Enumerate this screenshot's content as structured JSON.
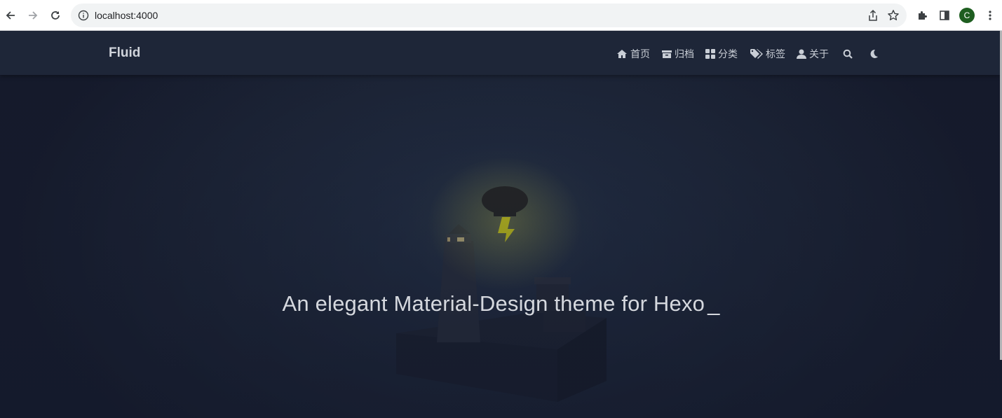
{
  "browser": {
    "url": "localhost:4000",
    "profile_initial": "C",
    "icons": [
      "back-arrow-icon",
      "forward-arrow-icon",
      "reload-icon",
      "info-icon",
      "share-icon",
      "star-icon",
      "extensions-icon",
      "side-panel-icon",
      "kebab-menu-icon"
    ]
  },
  "navbar": {
    "brand": "Fluid",
    "items": [
      {
        "label": "首页",
        "icon": "home-icon"
      },
      {
        "label": "归档",
        "icon": "archive-icon"
      },
      {
        "label": "分类",
        "icon": "grid-icon"
      },
      {
        "label": "标签",
        "icon": "tags-icon"
      },
      {
        "label": "关于",
        "icon": "user-icon"
      }
    ],
    "search_icon": "search-icon",
    "theme_icon": "moon-icon"
  },
  "banner": {
    "subtitle": "An elegant Material-Design theme for Hexo",
    "cursor": "_"
  },
  "colors": {
    "page_bg": "#1c2436",
    "navbar_bg": "#1e2638",
    "text": "#d5d8de",
    "lightning": "#d4d21a",
    "avatar": "#1e5e20"
  }
}
